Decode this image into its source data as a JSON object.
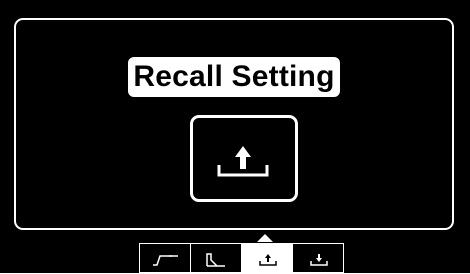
{
  "screen": {
    "title": "Recall Setting"
  },
  "main_icon": {
    "name": "recall-upload-icon"
  },
  "mode_bar": {
    "active_index": 2,
    "tabs": [
      {
        "icon": "pulse-edge-icon"
      },
      {
        "icon": "step-shape-icon"
      },
      {
        "icon": "recall-upload-icon"
      },
      {
        "icon": "save-download-icon"
      }
    ]
  },
  "colors": {
    "background": "#000000",
    "foreground": "#ffffff"
  }
}
